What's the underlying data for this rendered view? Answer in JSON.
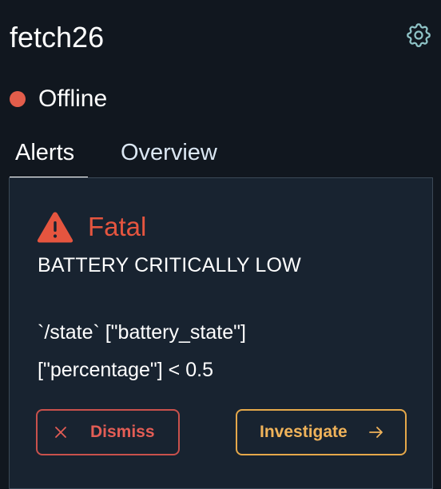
{
  "header": {
    "robot_name": "fetch26",
    "settings_icon": "gear-icon"
  },
  "status": {
    "label": "Offline",
    "color": "#e35d4b"
  },
  "tabs": [
    {
      "label": "Alerts",
      "active": true
    },
    {
      "label": "Overview",
      "active": false
    }
  ],
  "alert": {
    "severity": "Fatal",
    "severity_icon": "warning-triangle-icon",
    "severity_color": "#e5553f",
    "title": "BATTERY CRITICALLY LOW",
    "description_lines": [
      "`/state` [\"battery_state\"]",
      "[\"percentage\"] < 0.5"
    ],
    "actions": {
      "dismiss_label": "Dismiss",
      "dismiss_icon": "close-icon",
      "dismiss_color": "#e35d55",
      "investigate_label": "Investigate",
      "investigate_icon": "arrow-right-icon",
      "investigate_color": "#f0b35a"
    }
  }
}
